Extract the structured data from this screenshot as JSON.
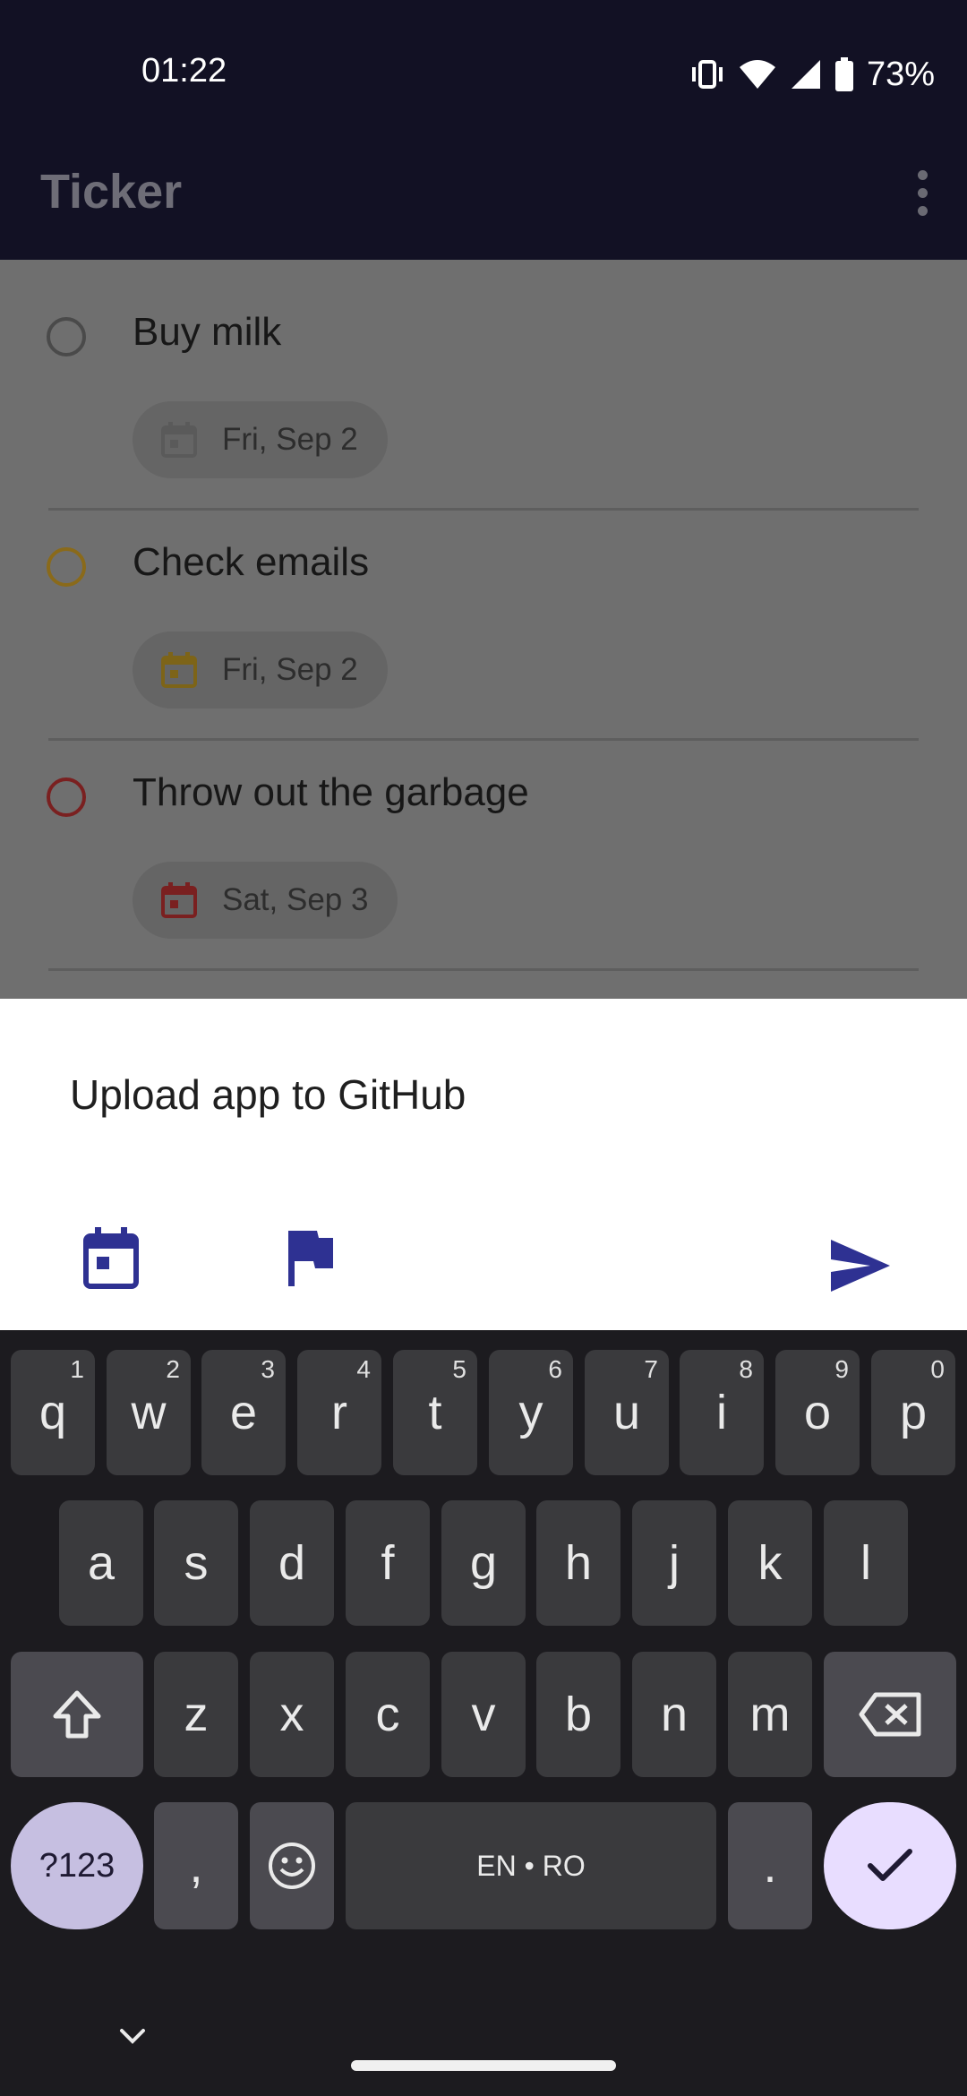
{
  "status": {
    "time": "01:22",
    "battery": "73%"
  },
  "app": {
    "title": "Ticker"
  },
  "tasks": [
    {
      "title": "Buy milk",
      "date": "Fri, Sep 2",
      "color": "#4a4a4a"
    },
    {
      "title": "Check emails",
      "date": "Fri, Sep 2",
      "color": "#8a6a1a"
    },
    {
      "title": "Throw out the garbage",
      "date": "Sat, Sep 3",
      "color": "#7a2020"
    }
  ],
  "new_task": {
    "value": "Upload app to GitHub"
  },
  "colors": {
    "accent": "#2e3192",
    "app_bar": "#121124",
    "scrim": "#6f6f6f"
  },
  "keyboard": {
    "row1": [
      {
        "k": "q",
        "n": "1"
      },
      {
        "k": "w",
        "n": "2"
      },
      {
        "k": "e",
        "n": "3"
      },
      {
        "k": "r",
        "n": "4"
      },
      {
        "k": "t",
        "n": "5"
      },
      {
        "k": "y",
        "n": "6"
      },
      {
        "k": "u",
        "n": "7"
      },
      {
        "k": "i",
        "n": "8"
      },
      {
        "k": "o",
        "n": "9"
      },
      {
        "k": "p",
        "n": "0"
      }
    ],
    "row2": [
      "a",
      "s",
      "d",
      "f",
      "g",
      "h",
      "j",
      "k",
      "l"
    ],
    "row3": [
      "z",
      "x",
      "c",
      "v",
      "b",
      "n",
      "m"
    ],
    "symbols_label": "?123",
    "comma": ",",
    "space_label": "EN • RO",
    "period": "."
  }
}
